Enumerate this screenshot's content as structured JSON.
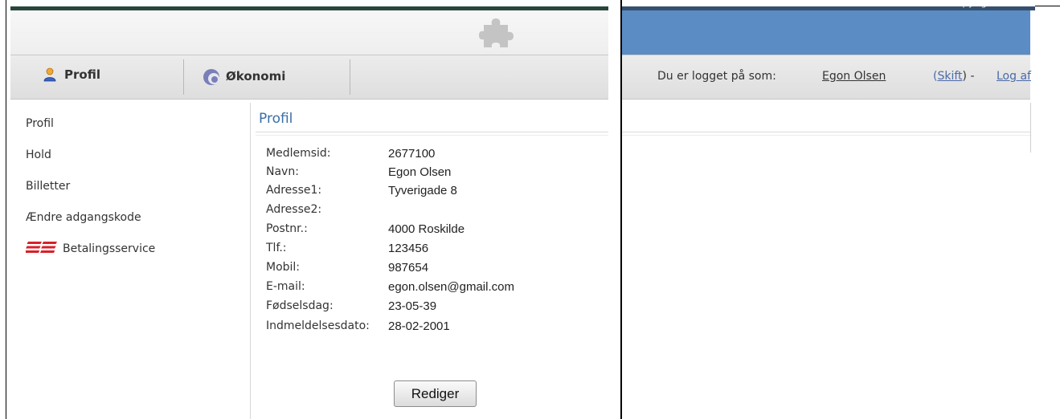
{
  "nav": {
    "tabs": [
      {
        "label": "Profil",
        "icon": "user-icon"
      },
      {
        "label": "Økonomi",
        "icon": "economy-icon"
      }
    ]
  },
  "sidebar": {
    "items": [
      {
        "label": "Profil"
      },
      {
        "label": "Hold"
      },
      {
        "label": "Billetter"
      },
      {
        "label": "Ændre adgangskode"
      },
      {
        "label": "Betalingsservice",
        "icon": "betalingsservice-logo"
      }
    ]
  },
  "profile": {
    "title": "Profil",
    "fields": [
      {
        "label": "Medlemsid:",
        "value": "2677100"
      },
      {
        "label": "Navn:",
        "value": "Egon Olsen"
      },
      {
        "label": "Adresse1:",
        "value": "Tyverigade 8"
      },
      {
        "label": "Adresse2:",
        "value": ""
      },
      {
        "label": "Postnr.:",
        "value": "4000 Roskilde"
      },
      {
        "label": "Tlf.:",
        "value": "123456"
      },
      {
        "label": "Mobil:",
        "value": "987654"
      },
      {
        "label": "E-mail:",
        "value": "egon.olsen@gmail.com"
      },
      {
        "label": "Fødselsdag:",
        "value": "23-05-39"
      },
      {
        "label": "Indmeldelsesdato:",
        "value": "28-02-2001"
      }
    ],
    "edit_label": "Rediger"
  },
  "header_right": {
    "copyright": "Conventus © Copyright",
    "logged_in_text": "Du er logget på som:",
    "user_name": "Egon Olsen",
    "switch_open": "(",
    "switch_label": "Skift",
    "switch_close": ") - ",
    "logout_label": "Log af"
  },
  "colors": {
    "accent_title": "#3a6ea5",
    "left_header_strip": "#28463a",
    "right_banner": "#5b8cc4",
    "link": "#4a6aa8"
  }
}
